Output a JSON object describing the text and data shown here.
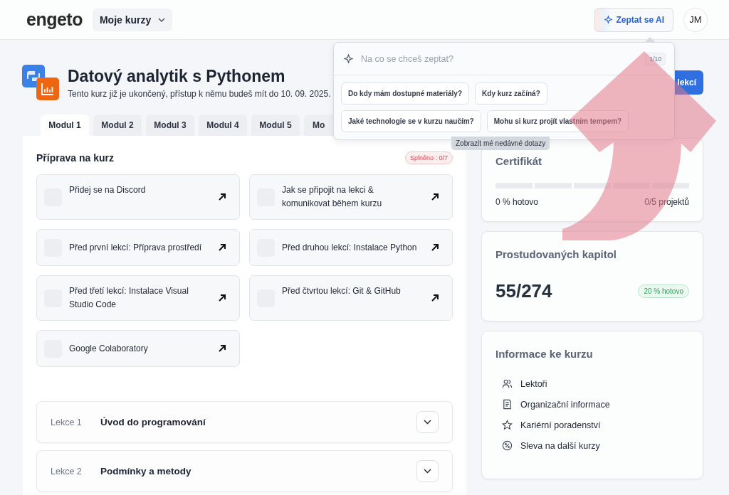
{
  "header": {
    "logo": "engeto",
    "menu": "Moje kurzy",
    "ai_button": "Zeptat se AI",
    "avatar": "JM"
  },
  "course": {
    "title": "Datový analytik s Pythonem",
    "notice": "Tento kurz již je ukončený, přístup k němu budeš mít do 10. 09. 2025.",
    "action_button": "lekcí"
  },
  "tabs": [
    {
      "label": "Modul 1",
      "selected": true
    },
    {
      "label": "Modul 2",
      "selected": false
    },
    {
      "label": "Modul 3",
      "selected": false
    },
    {
      "label": "Modul 4",
      "selected": false
    },
    {
      "label": "Modul 5",
      "selected": false
    },
    {
      "label": "Mo",
      "selected": false
    }
  ],
  "preparation": {
    "title": "Příprava na kurz",
    "badge": "Splněno : 0/7",
    "tasks": [
      {
        "label": "Přidej se na Discord",
        "checked": false
      },
      {
        "label": "Jak se připojit na lekci & komunikovat během kurzu",
        "checked": false
      },
      {
        "label": "Před první lekcí: Příprava prostředí",
        "checked": false
      },
      {
        "label": "Před druhou lekcí: Instalace Python",
        "checked": false
      },
      {
        "label": "Před třetí lekcí: Instalace Visual Studio Code",
        "checked": false
      },
      {
        "label": "Před čtvrtou lekcí: Git & GitHub",
        "checked": false
      },
      {
        "label": "Google Colaboratory",
        "checked": false
      }
    ]
  },
  "lessons": [
    {
      "number": "Lekce 1",
      "title": "Úvod do programování",
      "expanded": false
    },
    {
      "number": "Lekce 2",
      "title": "Podmínky a metody",
      "expanded": false
    }
  ],
  "certificate": {
    "title": "Certifikát",
    "level": 0,
    "progress": "0 % hotovo",
    "projects": "0/5 projektů"
  },
  "chapters": {
    "title": "Prostudovaných kapitol",
    "count": "55/274",
    "badge": "20 % hotovo"
  },
  "info": {
    "title": "Informace ke kurzu",
    "items": [
      {
        "kind": "people",
        "label": "Lektoři"
      },
      {
        "kind": "document",
        "label": "Organizační informace"
      },
      {
        "kind": "star",
        "label": "Kariérní poradenství"
      },
      {
        "kind": "percent",
        "label": "Sleva na další kurzy"
      }
    ]
  },
  "ai_popup": {
    "placeholder": "Na co se chceš zeptat?",
    "counter": "1/10",
    "suggestions": [
      "Do kdy mám dostupné materiály?",
      "Kdy kurz začíná?",
      "Jaké technologie se v kurzu naučím?",
      "Mohu si kurz projít vlastním tempem?"
    ],
    "tooltip": "Zobrazit mé nedávné dotazy"
  }
}
